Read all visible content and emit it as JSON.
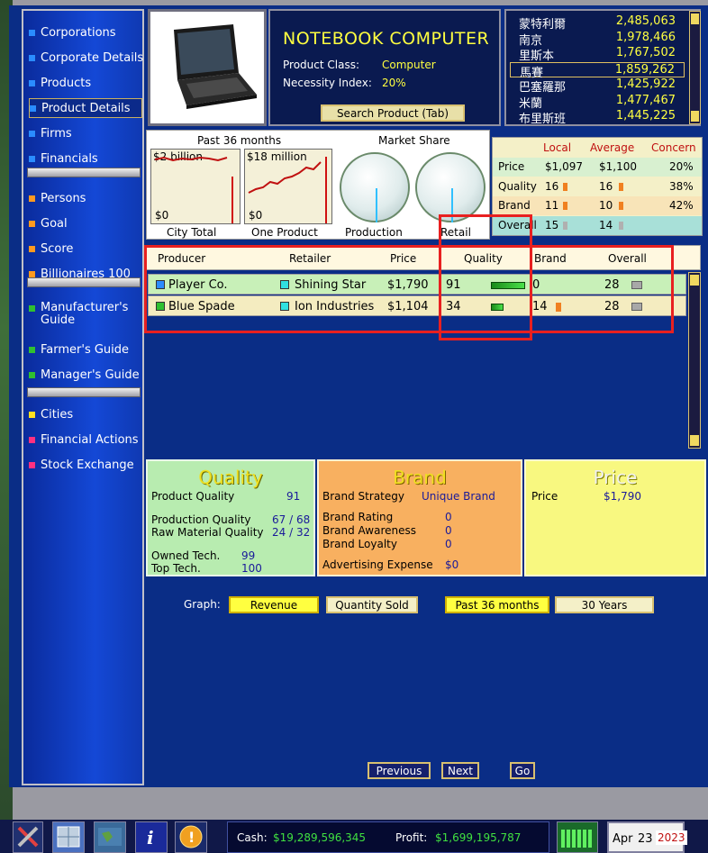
{
  "sidebar": {
    "items": [
      {
        "label": "Corporations",
        "color": "#2a8cff"
      },
      {
        "label": "Corporate Details",
        "color": "#2a8cff"
      },
      {
        "label": "Products",
        "color": "#2a8cff"
      },
      {
        "label": "Product Details",
        "color": "#2a8cff"
      },
      {
        "label": "Firms",
        "color": "#2a8cff"
      },
      {
        "label": "Financials",
        "color": "#2a8cff"
      },
      {
        "label": "Persons",
        "color": "#ff9a20"
      },
      {
        "label": "Goal",
        "color": "#ff9a20"
      },
      {
        "label": "Score",
        "color": "#ff9a20"
      },
      {
        "label": "Billionaires 100",
        "color": "#ff9a20"
      },
      {
        "label": "Manufacturer's Guide",
        "color": "#30c030"
      },
      {
        "label": "Farmer's Guide",
        "color": "#30c030"
      },
      {
        "label": "Manager's Guide",
        "color": "#30c030"
      },
      {
        "label": "Cities",
        "color": "#ffe020"
      },
      {
        "label": "Financial Actions",
        "color": "#ff3080"
      },
      {
        "label": "Stock Exchange",
        "color": "#ff3080"
      }
    ]
  },
  "product": {
    "name": "NOTEBOOK COMPUTER",
    "class_label": "Product Class:",
    "class_value": "Computer",
    "necessity_label": "Necessity Index:",
    "necessity_value": "20%",
    "search_button": "Search Product (Tab)"
  },
  "cities": [
    {
      "name": "蒙特利爾",
      "value": "2,485,063"
    },
    {
      "name": "南京",
      "value": "1,978,466"
    },
    {
      "name": "里斯本",
      "value": "1,767,502"
    },
    {
      "name": "馬賽",
      "value": "1,859,262"
    },
    {
      "name": "巴塞羅那",
      "value": "1,425,922"
    },
    {
      "name": "米蘭",
      "value": "1,477,467"
    },
    {
      "name": "布里斯班",
      "value": "1,445,225"
    }
  ],
  "charts": {
    "past_label": "Past 36 months",
    "market_share_label": "Market Share",
    "city_total": {
      "top": "$2 billion",
      "bottom": "$0",
      "caption": "City Total"
    },
    "one_product": {
      "top": "$18 million",
      "bottom": "$0",
      "caption": "One Product"
    },
    "production_caption": "Production",
    "retail_caption": "Retail"
  },
  "concern": {
    "headers": [
      "Local",
      "Average",
      "Concern"
    ],
    "rows": [
      {
        "label": "Price",
        "local": "$1,097",
        "average": "$1,100",
        "concern": "20%"
      },
      {
        "label": "Quality",
        "local": "16",
        "average": "16",
        "concern": "38%"
      },
      {
        "label": "Brand",
        "local": "11",
        "average": "10",
        "concern": "42%"
      },
      {
        "label": "Overall",
        "local": "15",
        "average": "14",
        "concern": ""
      }
    ]
  },
  "sellers": {
    "headers": [
      "Producer",
      "Retailer",
      "Price",
      "Quality",
      "Brand",
      "Overall"
    ],
    "rows": [
      {
        "producer": "Player Co.",
        "producer_color": "#2a8cff",
        "retailer": "Shining Star",
        "retailer_color": "#30e0e0",
        "price": "$1,790",
        "quality": "91",
        "brand": "0",
        "overall": "28"
      },
      {
        "producer": "Blue Spade",
        "producer_color": "#30c030",
        "retailer": "Ion Industries",
        "retailer_color": "#30e0e0",
        "price": "$1,104",
        "quality": "34",
        "brand": "14",
        "overall": "28"
      }
    ]
  },
  "quality_panel": {
    "title": "Quality",
    "product_quality_label": "Product Quality",
    "product_quality": "91",
    "production_quality_label": "Production Quality",
    "production_quality": "67 / 68",
    "raw_material_label": "Raw Material Quality",
    "raw_material": "24 / 32",
    "owned_tech_label": "Owned Tech.",
    "owned_tech": "99",
    "top_tech_label": "Top Tech.",
    "top_tech": "100"
  },
  "brand_panel": {
    "title": "Brand",
    "strategy_label": "Brand Strategy",
    "strategy": "Unique Brand",
    "rating_label": "Brand Rating",
    "rating": "0",
    "awareness_label": "Brand Awareness",
    "awareness": "0",
    "loyalty_label": "Brand Loyalty",
    "loyalty": "0",
    "ad_label": "Advertising Expense",
    "ad": "$0"
  },
  "price_panel": {
    "title": "Price",
    "price_label": "Price",
    "price": "$1,790"
  },
  "graph_controls": {
    "label": "Graph:",
    "revenue": "Revenue",
    "quantity": "Quantity Sold",
    "past36": "Past 36 months",
    "years30": "30 Years"
  },
  "nav": {
    "previous": "Previous",
    "next": "Next",
    "go": "Go"
  },
  "status": {
    "cash_label": "Cash:",
    "cash": "$19,289,596,345",
    "profit_label": "Profit:",
    "profit": "$1,699,195,787",
    "month": "Apr",
    "day": "23",
    "year": "2023"
  }
}
